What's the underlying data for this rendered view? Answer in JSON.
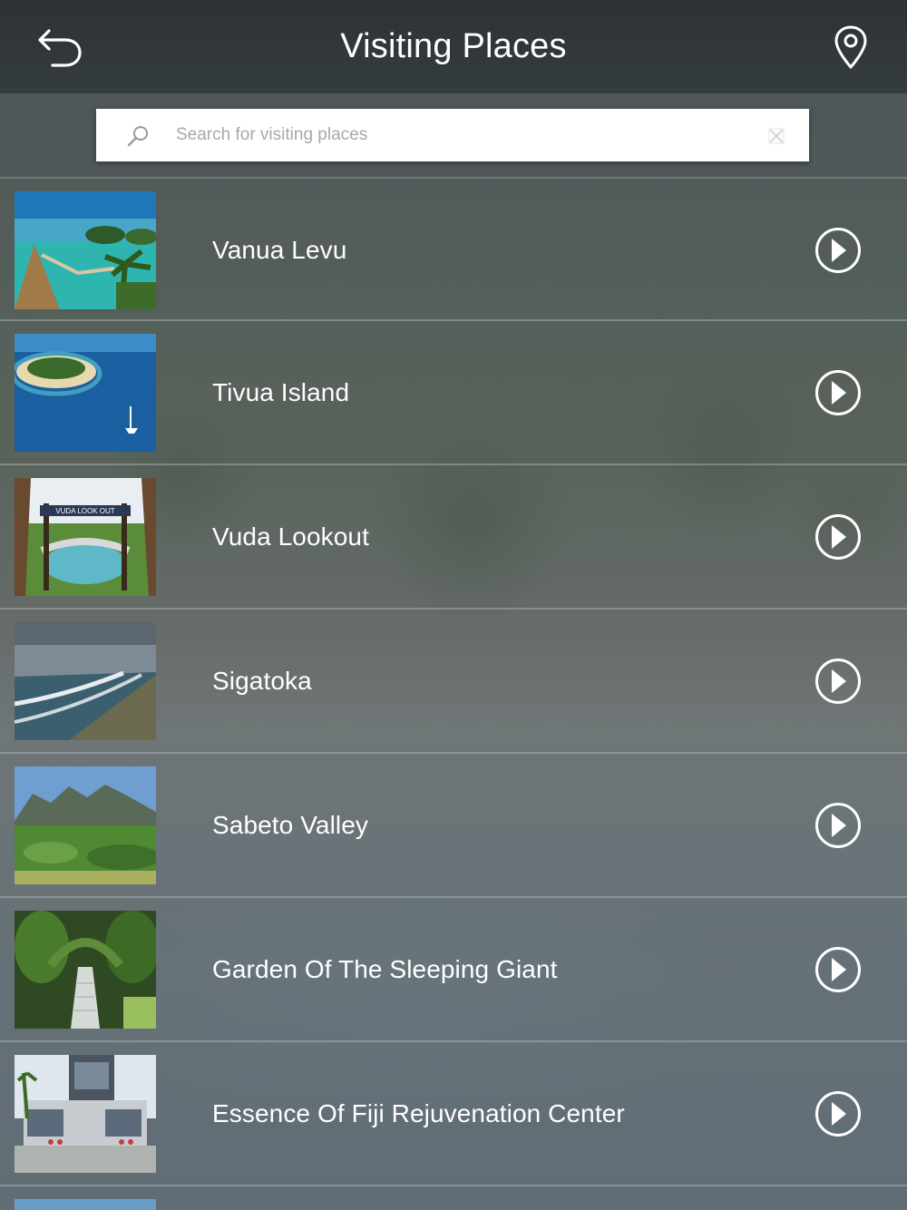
{
  "header": {
    "title": "Visiting Places",
    "back_icon": "back-arrow-icon",
    "location_icon": "map-pin-icon"
  },
  "search": {
    "placeholder": "Search for visiting places",
    "value": ""
  },
  "places": [
    {
      "name": "Vanua Levu",
      "thumbnail": "tropical-resort-photo"
    },
    {
      "name": "Tivua Island",
      "thumbnail": "island-aerial-photo"
    },
    {
      "name": "Vuda Lookout",
      "thumbnail": "lookout-gate-photo"
    },
    {
      "name": "Sigatoka",
      "thumbnail": "coastline-photo"
    },
    {
      "name": "Sabeto Valley",
      "thumbnail": "mountain-valley-photo"
    },
    {
      "name": "Garden Of The Sleeping Giant",
      "thumbnail": "garden-walkway-photo"
    },
    {
      "name": "Essence Of Fiji Rejuvenation Center",
      "thumbnail": "building-photo"
    }
  ],
  "thumbnail_sign_text": "VUDA LOOK OUT",
  "colors": {
    "header_bg": "#30373b",
    "text": "#ffffff",
    "search_bg": "#ffffff",
    "placeholder": "#a8a8a8"
  }
}
